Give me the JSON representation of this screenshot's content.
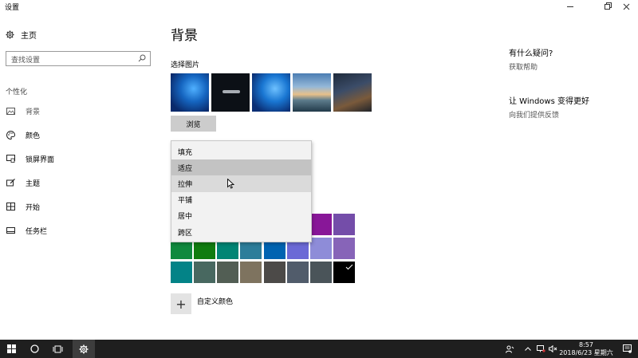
{
  "window": {
    "title": "设置"
  },
  "sidebar": {
    "home_label": "主页",
    "search_placeholder": "查找设置",
    "section_label": "个性化",
    "items": [
      {
        "label": "背景",
        "icon": "picture-icon"
      },
      {
        "label": "颜色",
        "icon": "palette-icon"
      },
      {
        "label": "锁屏界面",
        "icon": "lock-screen-icon"
      },
      {
        "label": "主题",
        "icon": "theme-brush-icon"
      },
      {
        "label": "开始",
        "icon": "start-tiles-icon"
      },
      {
        "label": "任务栏",
        "icon": "taskbar-icon"
      }
    ]
  },
  "main": {
    "title": "背景",
    "choose_picture_label": "选择图片",
    "thumbnails": [
      "windows-blue-1",
      "dark-logo",
      "windows-blue-2",
      "beach-sunset",
      "night-sky-rock"
    ],
    "browse_label": "浏览",
    "fit_dropdown": {
      "options": [
        "填充",
        "适应",
        "拉伸",
        "平铺",
        "居中",
        "跨区"
      ],
      "selected": "适应",
      "hovered": "拉伸"
    },
    "accent_colors": {
      "row0": [
        "#881798",
        "#744DA9"
      ],
      "row1": [
        "#10893E",
        "#107C10",
        "#018574",
        "#2D7D9A",
        "#0063B1",
        "#6B69D6",
        "#8E8CD8",
        "#8764B8"
      ],
      "row2": [
        "#038387",
        "#486860",
        "#525E54",
        "#7E735F",
        "#4C4A48",
        "#515C6B",
        "#4A5459",
        "#000000"
      ],
      "selected": "#000000"
    },
    "custom_color_label": "自定义颜色"
  },
  "right_panel": {
    "help_heading": "有什么疑问?",
    "help_link": "获取帮助",
    "feedback_heading": "让 Windows 变得更好",
    "feedback_link": "向我们提供反馈"
  },
  "taskbar": {
    "time": "8:57",
    "date": "2018/6/23 星期六"
  }
}
